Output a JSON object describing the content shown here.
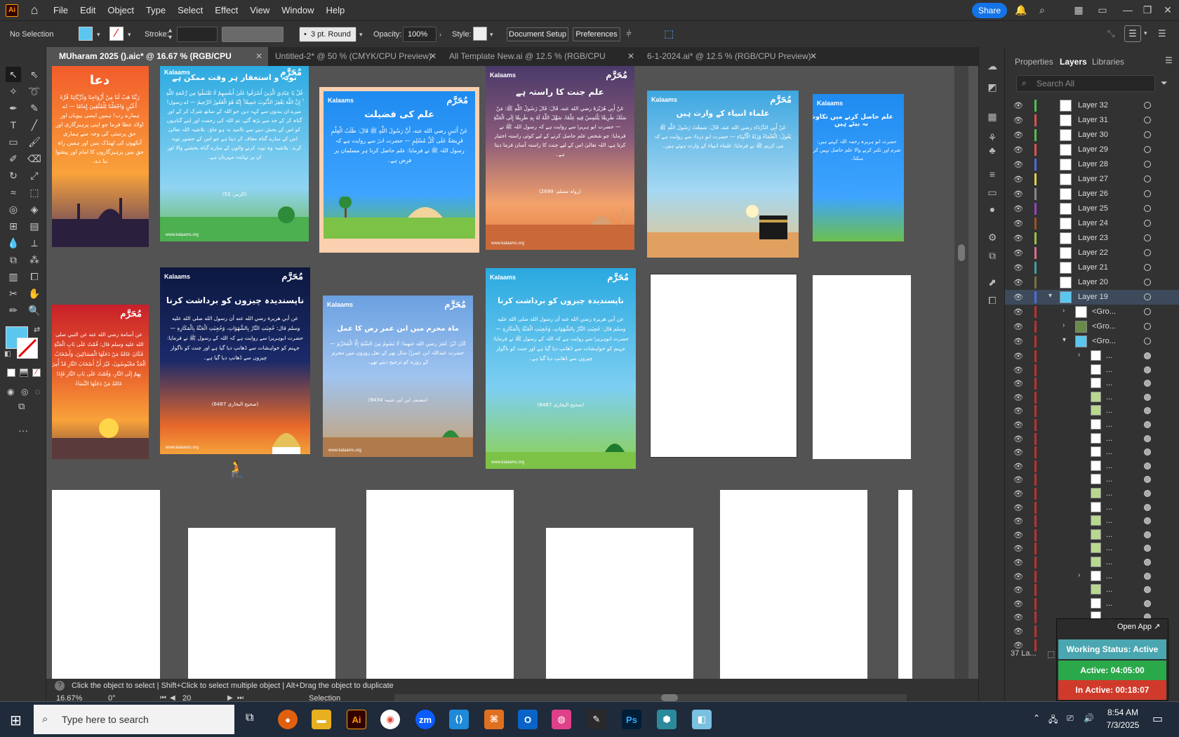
{
  "menubar": {
    "items": [
      "File",
      "Edit",
      "Object",
      "Type",
      "Select",
      "Effect",
      "View",
      "Window",
      "Help"
    ],
    "share": "Share",
    "app_logo": "Ai"
  },
  "control": {
    "selection": "No Selection",
    "stroke_label": "Stroke:",
    "brush": "3 pt. Round",
    "opacity_label": "Opacity:",
    "opacity": "100%",
    "style_label": "Style:",
    "document_setup": "Document Setup",
    "preferences": "Preferences"
  },
  "tabs": [
    {
      "label": "MUharam 2025 ().aic* @ 16.67 % (RGB/CPU Preview)",
      "active": true
    },
    {
      "label": "Untitled-2* @ 50 % (CMYK/CPU Preview)",
      "active": false
    },
    {
      "label": "All Template New.ai @ 12.5 % (RGB/CPU Preview)",
      "active": false
    },
    {
      "label": "6-1-2024.ai* @ 12.5 % (RGB/CPU Preview)",
      "active": false
    }
  ],
  "posts": {
    "brand": "Kalaams",
    "muharram": "مُحَرَّم",
    "footer": "www.kalaams.org",
    "p1": {
      "title": "دعا",
      "body": "رَبَّنَا هَبْ لَنَا مِنْ أَزْوَاجِنَا وَذُرِّيَّاتِنَا قُرَّةَ أَعْيُنٍ وَاجْعَلْنَا لِلْمُتَّقِينَ إِمَامًا — اے ہمارے رب! ہمیں ایسی بیویاں اور اولاد عطا فرما جو اپنی پرہیزگاری اور حق پرستی کی وجہ سے ہماری آنکھوں کی ٹھنڈک بنیں اور ہمیں راہ حق میں پرہیزگاروں کا امام اور پیشوا بنا دے۔"
    },
    "p2": {
      "title": "توبہ و استغفار ہر وقت ممکن ہے",
      "body": "قُلْ يَا عِبَادِيَ الَّذِينَ أَسْرَفُوا عَلَىٰ أَنفُسِهِمْ لَا تَقْنَطُوا مِن رَّحْمَةِ اللَّهِ ۚ إِنَّ اللَّهَ يَغْفِرُ الذُّنُوبَ جَمِيعًا ۚ إِنَّهُ هُوَ الْغَفُورُ الرَّحِيمُ — اے رسول! میرے ان بندوں سے کہہ دیں جو اللہ کے ساتھ شرک کر کے اور گناہ کر کے حد سے بڑھ گئے، تم اللہ کی رحمت اور اپنے گناہوں کو اس کے بخش دینے سے ناامید نہ ہو جاؤ۔ بلاشبہ اللہ تعالیٰ اس کے سارے گناہ معاف کر دیتا ہے جو اس کے حضور توبہ کرے۔ بلاشبہ وہ توبہ کرنے والوں کے سارے گناہ بخشنے والا اور ان پر نہایت مہربان ہے۔",
      "ref": "(الزمر: 53)"
    },
    "p3": {
      "title": "علم کی فضیلت",
      "body": "عَنْ أَنَسٍ رضي الله عنه، أَنَّ رَسُولَ اللَّهِ ﷺ قَالَ: طَلَبُ الْعِلْمِ فَرِيضَةٌ عَلَى كُلِّ مُسْلِمٍ — حضرت انسؓ سے روایت ہے کہ رسول اللہ ﷺ نے فرمایا: علم حاصل کرنا ہر مسلمان پر فرض ہے۔"
    },
    "p4": {
      "title": "علم جنت کا راستہ ہے",
      "body": "عَنْ أَبِي هُرَيْرَةَ رضي الله عنه، قَالَ: قَالَ رَسُولُ اللَّهِ ﷺ: مَنْ سَلَكَ طَرِيقًا يَلْتَمِسُ فِيهِ عِلْمًا، سَهَّلَ اللَّهُ لَهُ بِهِ طَرِيقًا إِلَى الْجَنَّةِ — حضرت ابو ہریرہؓ سے روایت ہے کہ رسول اللہ ﷺ نے فرمایا: جو شخص علم حاصل کرنے کے لیے کوئی راستہ اختیار کرتا ہے، اللہ تعالیٰ اس کے لیے جنت کا راستہ آسان فرما دیتا ہے۔",
      "ref": "(رواہ مسلم: 2699)"
    },
    "p5": {
      "title": "علماء انبیاء کے وارث ہیں",
      "body": "عَنْ أَبِي الدَّرْدَاءِ رضي الله عنه، قَالَ: سَمِعْتُ رَسُولَ اللَّهِ ﷺ يَقُولُ: الْعُلَمَاءُ وَرَثَةُ الْأَنْبِيَاءِ — حضرت ابو درداءؓ سے روایت ہے کہ نبی کریم ﷺ نے فرمایا: علماء انبیاء کے وارث ہوتے ہیں۔"
    },
    "p6": {
      "title": "علم حاصل کرنے میں تکاوٹ نہ بیٹے ہیں",
      "body": "حضرت ابو ہریرہ رحمہ اللہ کہتے ہیں: شرم اور تکبر کرنے والا علم حاصل نہیں کر سکتا۔"
    },
    "p7": {
      "title": "",
      "body": "عن أسامة رضي الله عنه عن النبي صلى الله عليه وسلم قال: قُمْتُ عَلَى بَابِ الْجَنَّةِ فَكَانَ عَامَّةُ مَنْ دَخَلَهَا الْمَسَاكِينَ، وَأَصْحَابُ الْجَدِّ مَحْبُوسُونَ، غَيْرَ أَنَّ أَصْحَابَ النَّارِ قَدْ أُمِرَ بِهِمْ إِلَى النَّارِ، وَقُمْتُ عَلَى بَابِ النَّارِ فَإِذَا عَامَّةُ مَنْ دَخَلَهَا النِّسَاءُ"
    },
    "p8": {
      "title": "ناپسندیدہ چیزوں کو برداشت کرنا",
      "body": "عن أبي هريرة رضي الله عنه أن رسول الله صلى الله عليه وسلم قال: حُجِبَتِ النَّارُ بِالشَّهَوَاتِ، وَحُجِبَتِ الْجَنَّةُ بِالْمَكَارِهِ — حضرت ابوہریرہؓ سے روایت ہے کہ اللہ کے رسول ﷺ نے فرمایا: جہنم کو خواہشات سے ڈھانپ دیا گیا ہے اور جنت کو ناگوار چیزوں سے ڈھانپ دیا گیا ہے۔",
      "ref": "(صحیح البخاری 6487)"
    },
    "p9": {
      "title": "ماہ محرم میں ابن عمر رض کا عمل",
      "body": "كَانَ ابْنُ عُمَرَ رضي الله عنهما: لَا يَصُومُ مِنَ السَّنَةِ إِلَّا الْمُحَرَّمَ — حضرت عبداللہ ابن عمرؓ سال بھر کے نفل روزوں میں محرم کے روزے کو ترجیح دیتے تھے۔",
      "ref": "(مصنف ابن ابی شیبہ 9434)"
    },
    "p10": {
      "title": "ناپسندیدہ چیزوں کو برداشت کرنا",
      "body": "عن أبي هريرة رضي الله عنه أن رسول الله صلى الله عليه وسلم قال: حُجِبَتِ النَّارُ بِالشَّهَوَاتِ، وَحُجِبَتِ الْجَنَّةُ بِالْمَكَارِهِ — حضرت ابوہریرہؓ سے روایت ہے کہ اللہ کے رسول ﷺ نے فرمایا: جہنم کو خواہشات سے ڈھانپ دیا گیا ہے اور جنت کو ناگوار چیزوں سے ڈھانپ دیا گیا ہے۔",
      "ref": "(صحیح البخاری 6487)"
    }
  },
  "panel": {
    "tabs": [
      "Properties",
      "Layers",
      "Libraries"
    ],
    "search_placeholder": "Search All",
    "layers": [
      "Layer 32",
      "Layer 31",
      "Layer 30",
      "Layer 29",
      "Layer 28",
      "Layer 27",
      "Layer 26",
      "Layer 25",
      "Layer 24",
      "Layer 23",
      "Layer 22",
      "Layer 21",
      "Layer 20",
      "Layer 19"
    ],
    "sublayers": [
      "<Gro...",
      "<Gro...",
      "<Gro..."
    ],
    "item_label": "...",
    "footer_count": "37 La...",
    "open_app": "Open App ↗"
  },
  "widget": {
    "status": "Working Status: Active",
    "active": "Active: 04:05:00",
    "inactive": "In Active: 00:18:07"
  },
  "status": {
    "hint": "Click the object to select  |  Shift+Click to select multiple object  |  Alt+Drag the object to duplicate",
    "zoom": "16.67%",
    "rotation": "0°",
    "artboard": "20",
    "tool": "Selection"
  },
  "taskbar": {
    "search_placeholder": "Type here to search",
    "time": "8:54 AM",
    "date": "7/3/2025"
  }
}
